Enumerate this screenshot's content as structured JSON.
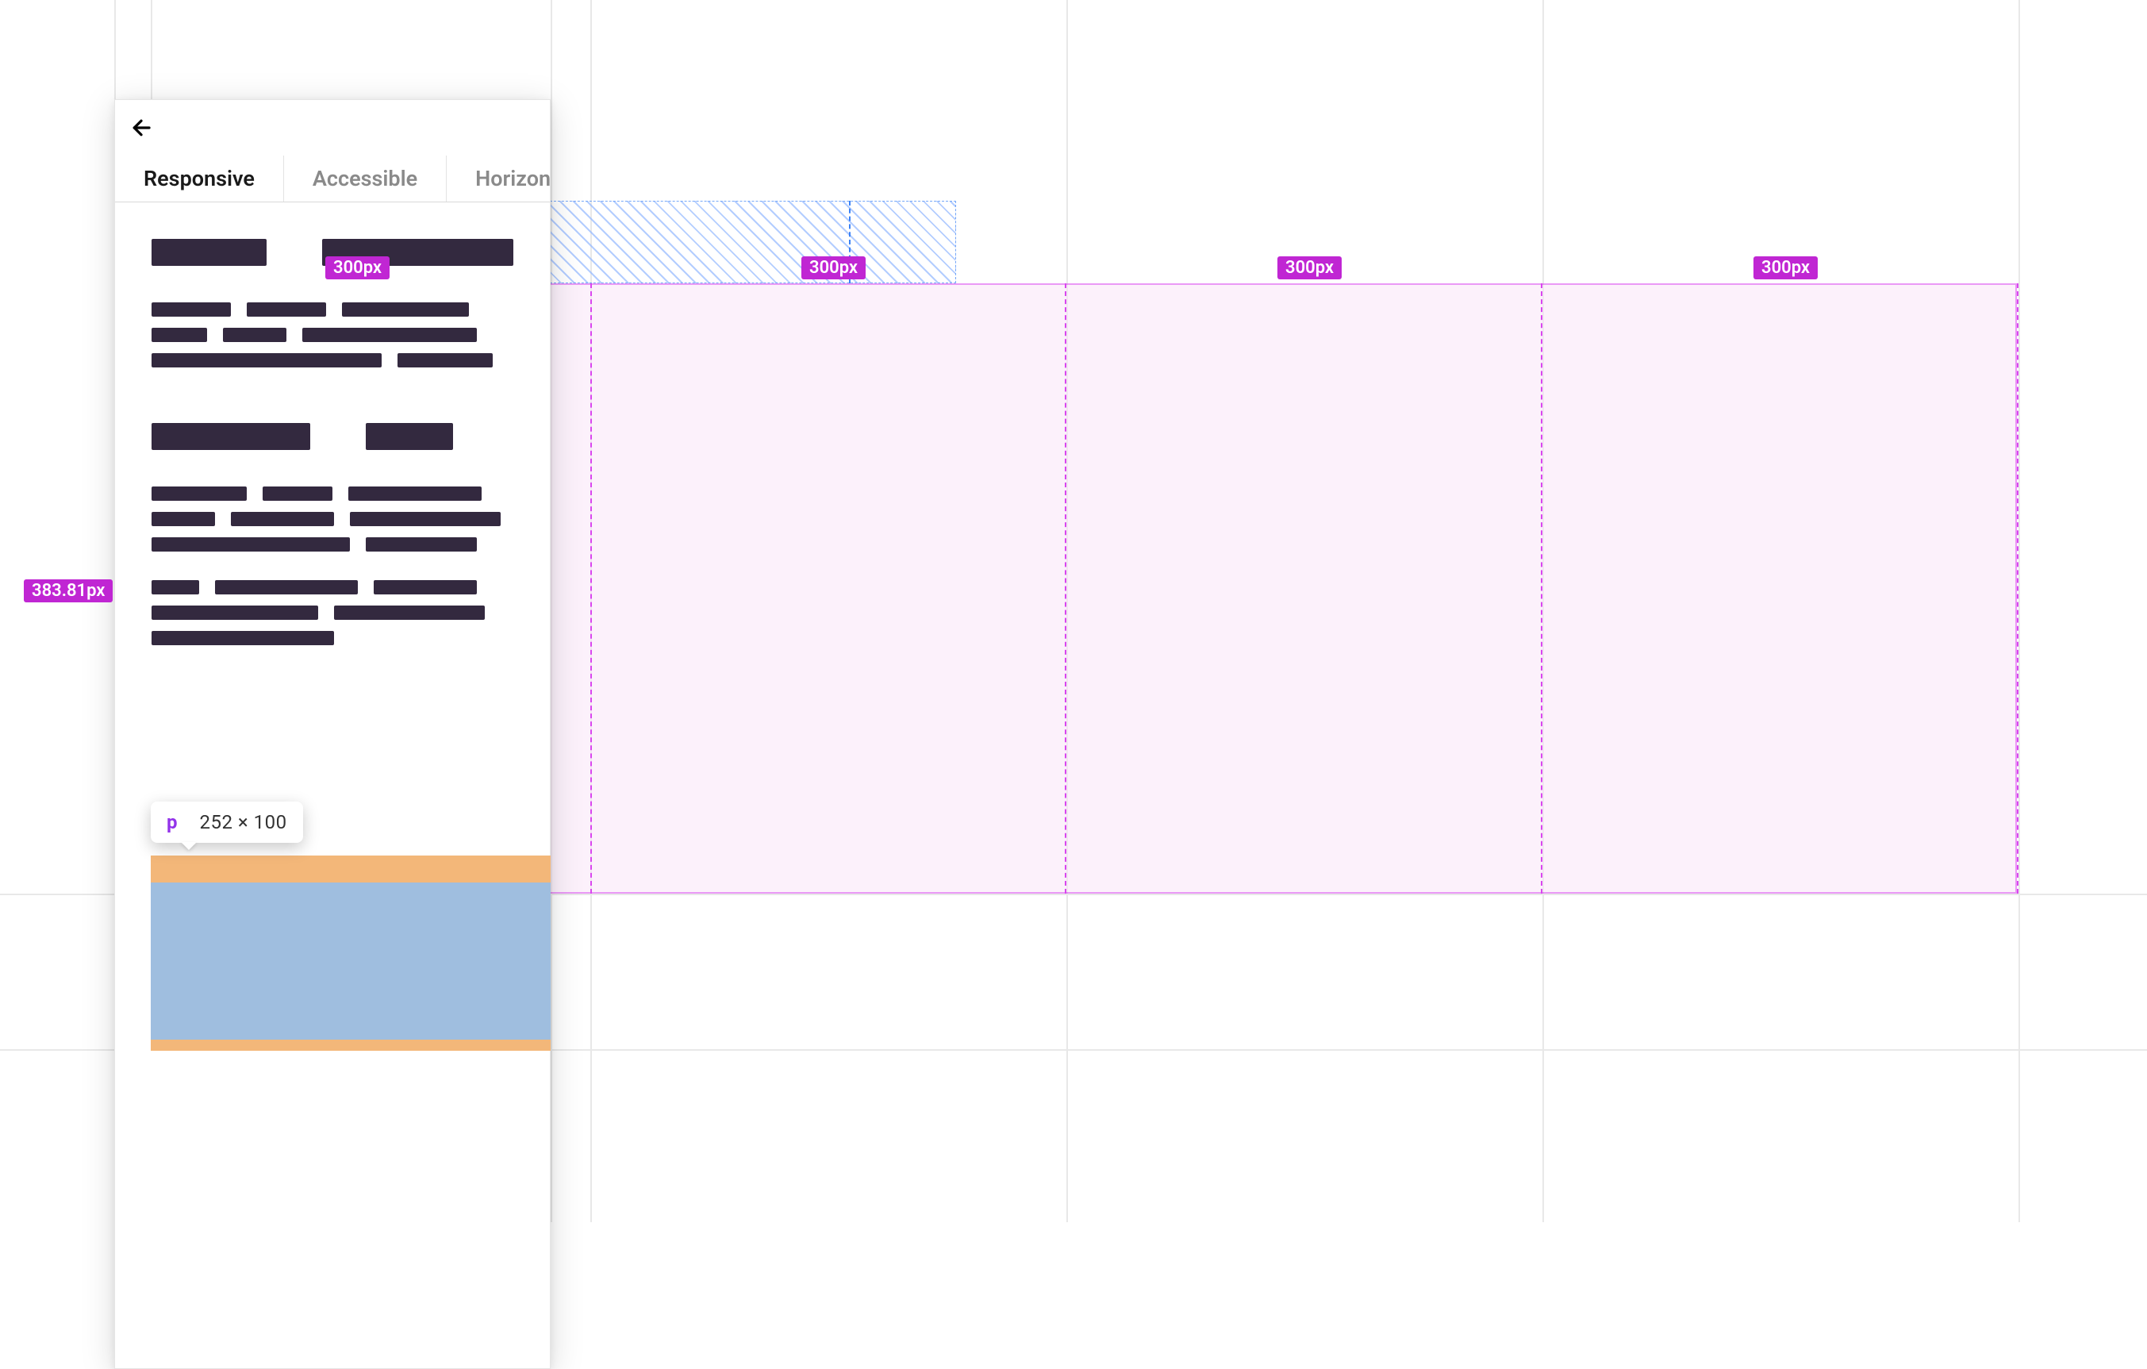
{
  "tabs": {
    "items": [
      {
        "label": "Responsive",
        "active": true
      },
      {
        "label": "Accessible",
        "active": false
      },
      {
        "label": "Horizontal",
        "active": false
      }
    ]
  },
  "column_badges": [
    "300px",
    "300px",
    "300px",
    "300px"
  ],
  "height_badge": "383.81px",
  "tooltip": {
    "tag": "p",
    "dimensions": "252 × 100"
  },
  "colors": {
    "selection": "#d946ef",
    "selection_fill": "#fae6f8",
    "badge": "#c026d3",
    "guide_blue": "#3b82f6",
    "margin_box": "#f3b779",
    "content_box": "#9fbedf",
    "placeholder": "#33293f"
  }
}
